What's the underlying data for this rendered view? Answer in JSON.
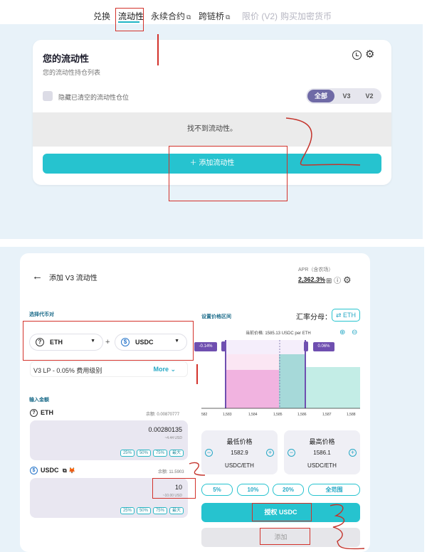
{
  "nav": {
    "swap": "兑换",
    "liquidity": "流动性",
    "perpetual": "永续合约",
    "bridge": "跨链桥",
    "limit": "限价 (V2)",
    "buy_crypto": "购买加密货币"
  },
  "liquidity_card": {
    "title": "您的流动性",
    "subtitle": "您的流动性持仓列表",
    "hide_closed_label": "隐藏已清空的流动性仓位",
    "filters": [
      "全部",
      "V3",
      "V2"
    ],
    "active_filter": "全部",
    "empty_text": "找不到流动性。",
    "add_button": "＋  添加流动性"
  },
  "add_v3": {
    "title": "添加 V3 流动性",
    "apr_label": "APR（含农场）",
    "apr_value": "2,362.3%",
    "select_tokens_label": "选择代币对",
    "token_a": "ETH",
    "token_b": "USDC",
    "fee_tier": "V3 LP - 0.05% 费用级别",
    "fee_more": "More ⌄",
    "deposit_label": "输入金额",
    "eth": {
      "symbol": "ETH",
      "balance": "余额: 0.00870777",
      "amount": "0.00280135",
      "usd": "~4.44 USD"
    },
    "usdc": {
      "symbol": "USDC",
      "balance": "余额: 11.5903",
      "amount": "10",
      "usd": "~10.00 USD"
    },
    "percent_buttons": [
      "25%",
      "50%",
      "75%",
      "最大"
    ],
    "range_label": "设置价格区间",
    "rate_label": "汇率分母：",
    "rate_button": "⇄ ETH",
    "current_price": "当前价格: 1585.13 USDC per ETH",
    "chart_low_pct": "-0.14%",
    "chart_high_pct": "0.06%",
    "axis_ticks": [
      "582",
      "1,583",
      "1,584",
      "1,585",
      "1,586",
      "1,587",
      "1,588"
    ],
    "min_price": {
      "title": "最低价格",
      "value": "1582.9",
      "unit": "USDC/ETH"
    },
    "max_price": {
      "title": "最高价格",
      "value": "1586.1",
      "unit": "USDC/ETH"
    },
    "presets": [
      "5%",
      "10%",
      "20%",
      "全范围"
    ],
    "approve_button": "授权 USDC",
    "add_button": "添加"
  },
  "colors": {
    "accent": "#26c3cf",
    "purple": "#6f6aa6",
    "annotation": "#d3322b"
  }
}
